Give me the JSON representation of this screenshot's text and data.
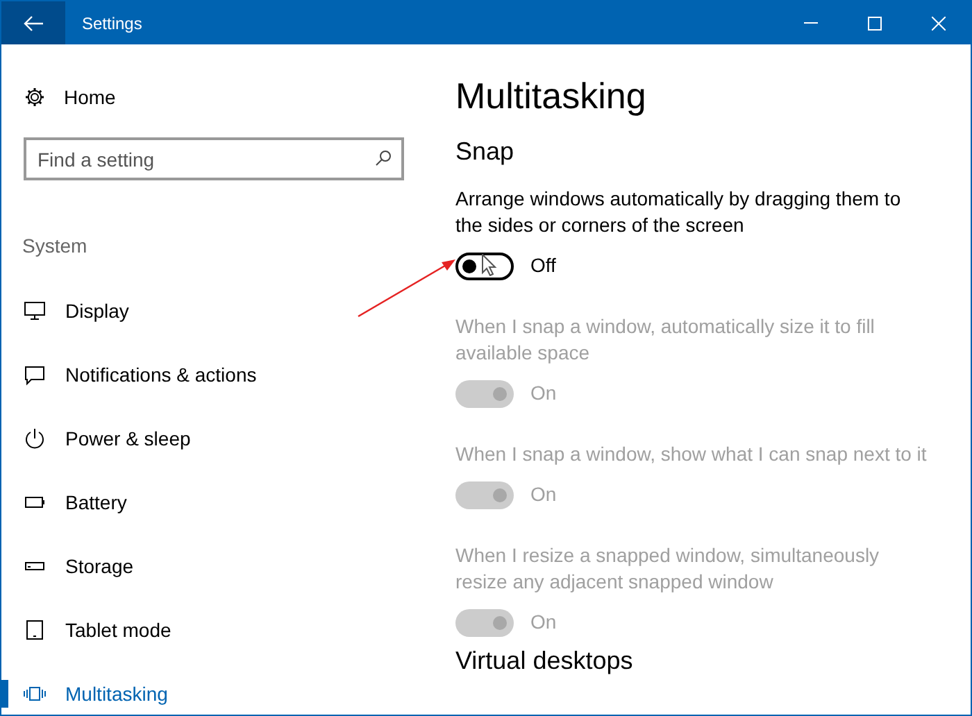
{
  "window": {
    "title": "Settings"
  },
  "sidebar": {
    "home": "Home",
    "search": {
      "placeholder": "Find a setting"
    },
    "section": "System",
    "items": [
      {
        "label": "Display",
        "kind": "display",
        "selected": false
      },
      {
        "label": "Notifications & actions",
        "kind": "notifications",
        "selected": false
      },
      {
        "label": "Power & sleep",
        "kind": "power",
        "selected": false
      },
      {
        "label": "Battery",
        "kind": "battery",
        "selected": false
      },
      {
        "label": "Storage",
        "kind": "storage",
        "selected": false
      },
      {
        "label": "Tablet mode",
        "kind": "tablet",
        "selected": false
      },
      {
        "label": "Multitasking",
        "kind": "multitasking",
        "selected": true
      }
    ]
  },
  "page": {
    "title": "Multitasking",
    "section": "Snap",
    "settings": [
      {
        "description": "Arrange windows automatically by dragging them to the sides or corners of the screen",
        "on": false,
        "disabled": false,
        "state_label": "Off"
      },
      {
        "description": "When I snap a window, automatically size it to fill available space",
        "on": true,
        "disabled": true,
        "state_label": "On"
      },
      {
        "description": "When I snap a window, show what I can snap next to it",
        "on": true,
        "disabled": true,
        "state_label": "On"
      },
      {
        "description": "When I resize a snapped window, simultaneously resize any adjacent snapped window",
        "on": true,
        "disabled": true,
        "state_label": "On"
      }
    ],
    "next_section": "Virtual desktops"
  }
}
